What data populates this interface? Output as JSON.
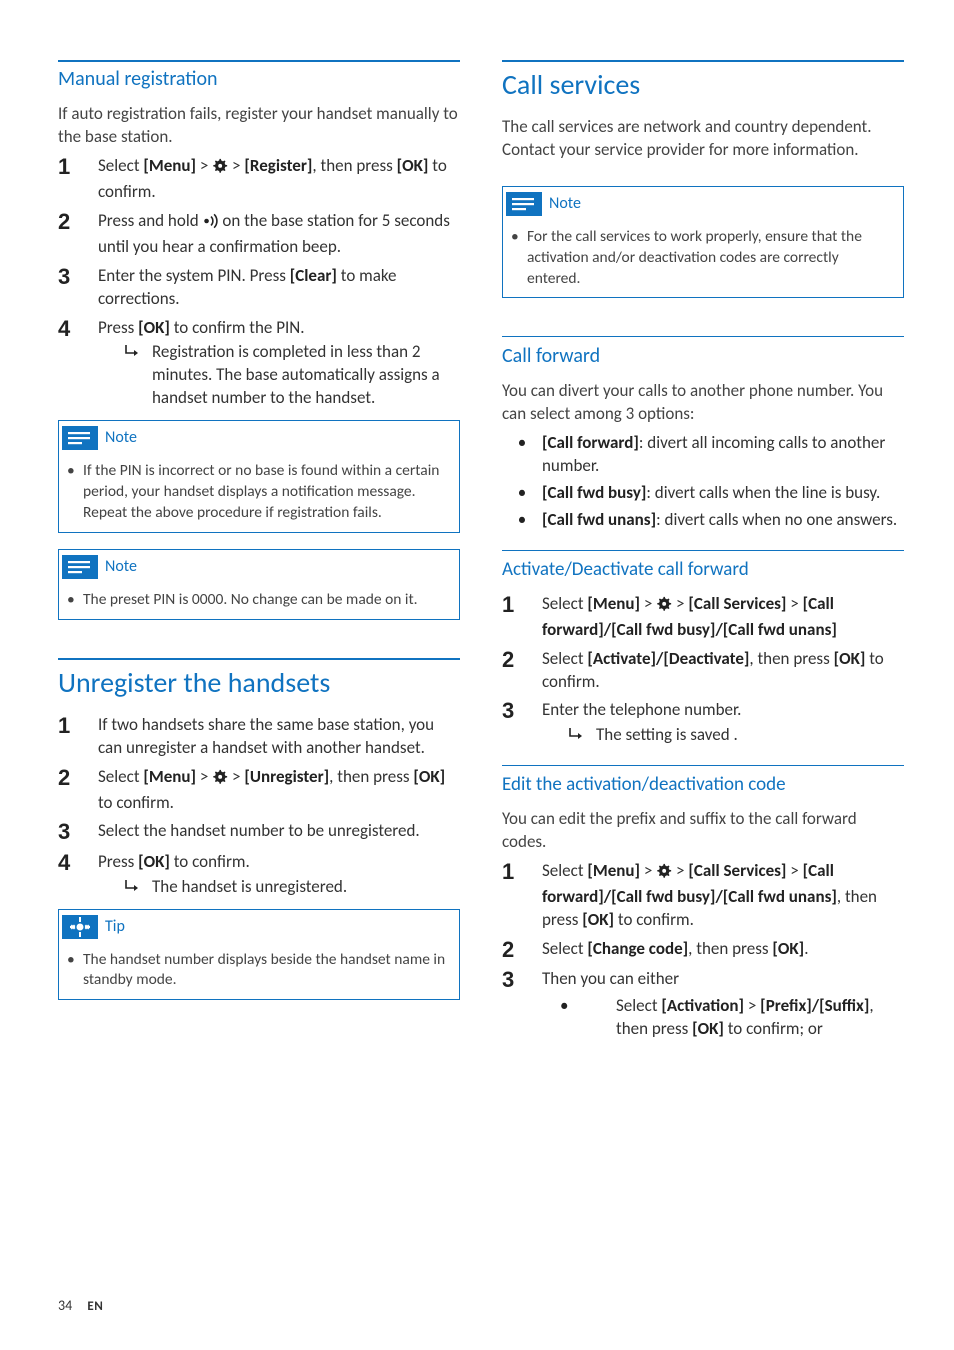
{
  "left": {
    "manual_registration": {
      "heading": "Manual registration",
      "intro": "If auto registration fails, register your handset manually to the base station.",
      "step1_a": "Select ",
      "step1_menu": "[Menu]",
      "step1_gt1": " > ",
      "step1_gt2": " > ",
      "step1_register": "[Register]",
      "step1_b": ", then press ",
      "step1_ok": "[OK]",
      "step1_c": " to confirm.",
      "step2_a": "Press and hold ",
      "step2_b": " on the base station for 5 seconds until you hear a confirmation beep.",
      "step3_a": "Enter the system PIN. Press ",
      "step3_clear": "[Clear]",
      "step3_b": " to make corrections.",
      "step4_a": "Press ",
      "step4_ok": "[OK]",
      "step4_b": " to confirm the PIN.",
      "step4_result": "Registration is completed in less than 2 minutes. The base automatically assigns a handset number to the handset."
    },
    "note1_label": "Note",
    "note1_body": "If the PIN is incorrect or no base is found within a certain period, your handset displays a notification message. Repeat the above procedure if registration fails.",
    "note2_label": "Note",
    "note2_body": "The preset PIN is 0000. No change can be made on it.",
    "unregister": {
      "heading": "Unregister the handsets",
      "step1": "If two handsets share the same base station, you can unregister a handset with another handset.",
      "step2_a": "Select ",
      "step2_menu": "[Menu]",
      "step2_gt1": " > ",
      "step2_gt2": " > ",
      "step2_unreg": "[Unregister]",
      "step2_b": ", then press ",
      "step2_ok": "[OK]",
      "step2_c": " to confirm.",
      "step3": "Select the handset number to be unregistered.",
      "step4_a": "Press ",
      "step4_ok": "[OK]",
      "step4_b": " to confirm.",
      "step4_result": "The handset is unregistered."
    },
    "tip_label": "Tip",
    "tip_body": "The handset number displays beside the handset name in standby mode."
  },
  "right": {
    "call_services": {
      "heading": "Call services",
      "intro": "The call services are network and country dependent. Contact your service provider for more information."
    },
    "note_label": "Note",
    "note_body": "For the call services to work properly, ensure that the activation and/or deactivation codes are correctly entered.",
    "call_forward": {
      "heading": "Call forward",
      "intro": "You can divert your calls to another phone number. You can select among 3 options:",
      "opt1_b": "[Call forward]",
      "opt1_t": ": divert all incoming calls to another number.",
      "opt2_b": "[Call fwd busy]",
      "opt2_t": ": divert calls when the line is busy.",
      "opt3_b": "[Call fwd unans]",
      "opt3_t": ": divert calls when no one answers."
    },
    "activate": {
      "heading": "Activate/Deactivate call forward",
      "s1_a": "Select ",
      "s1_menu": "[Menu]",
      "s1_gt1": " > ",
      "s1_gt2": " > ",
      "s1_cs": "[Call Services]",
      "s1_gt3": " > ",
      "s1_opts": "[Call forward]/[Call fwd busy]/[Call fwd unans]",
      "s2_a": "Select ",
      "s2_act": "[Activate]/[Deactivate]",
      "s2_b": ", then press ",
      "s2_ok": "[OK]",
      "s2_c": " to confirm.",
      "s3": "Enter the telephone number.",
      "s3_result": "The setting is saved ."
    },
    "edit": {
      "heading": "Edit the activation/deactivation code",
      "intro": "You can edit the prefix and suffix to the call forward codes.",
      "s1_a": "Select ",
      "s1_menu": "[Menu]",
      "s1_gt1": " > ",
      "s1_gt2": " > ",
      "s1_cs": "[Call Services]",
      "s1_gt3": " > ",
      "s1_opts": "[Call forward]/[Call fwd busy]/[Call fwd unans]",
      "s1_b": ", then press ",
      "s1_ok": "[OK]",
      "s1_c": " to confirm.",
      "s2_a": "Select ",
      "s2_cc": "[Change code]",
      "s2_b": ", then press ",
      "s2_ok": "[OK]",
      "s2_c": ".",
      "s3": "Then you can either",
      "s3_sub_a": "Select ",
      "s3_sub_act": "[Activation]",
      "s3_sub_gt": " > ",
      "s3_sub_ps": "[Prefix]/[Suffix]",
      "s3_sub_b": ", then press ",
      "s3_sub_ok": "[OK]",
      "s3_sub_c": " to confirm; or"
    }
  },
  "footer": {
    "page": "34",
    "lang": "EN"
  }
}
